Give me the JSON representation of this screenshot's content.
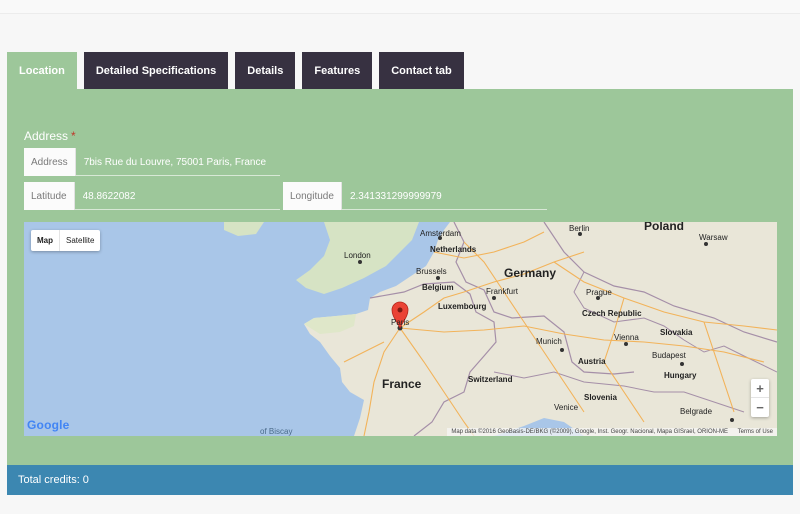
{
  "tabs": [
    {
      "label": "Location"
    },
    {
      "label": "Detailed Specifications"
    },
    {
      "label": "Details"
    },
    {
      "label": "Features"
    },
    {
      "label": "Contact tab"
    }
  ],
  "location": {
    "address_label": "Address",
    "required_marker": "*",
    "address": {
      "addon": "Address",
      "value": "7bis Rue du Louvre, 75001 Paris, France"
    },
    "latitude": {
      "addon": "Latitude",
      "value": "48.8622082"
    },
    "longitude": {
      "addon": "Longitude",
      "value": "2.341331299999979"
    }
  },
  "map": {
    "type_buttons": {
      "map": "Map",
      "satellite": "Satellite"
    },
    "zoom_in": "+",
    "zoom_out": "−",
    "logo": "Google",
    "attribution": "Map data ©2016 GeoBasis-DE/BKG (©2009), Google, Inst. Geogr. Nacional, Mapa GISrael, ORION-ME",
    "terms": "Terms of Use",
    "labels": {
      "poland": "Poland",
      "germany": "Germany",
      "france": "France",
      "london": "London",
      "amsterdam": "Amsterdam",
      "netherlands": "Netherlands",
      "brussels": "Brussels",
      "belgium": "Belgium",
      "luxembourg": "Luxembourg",
      "frankfurt": "Frankfurt",
      "berlin": "Berlin",
      "warsaw": "Warsaw",
      "prague": "Prague",
      "czech": "Czech Republic",
      "slovakia": "Slovakia",
      "munich": "Munich",
      "vienna": "Vienna",
      "austria": "Austria",
      "budapest": "Budapest",
      "hungary": "Hungary",
      "switzerland": "Switzerland",
      "paris": "Paris",
      "slovenia": "Slovenia",
      "venice": "Venice",
      "belgrade": "Belgrade",
      "bay": "of Biscay"
    }
  },
  "footer": {
    "credits": "Total credits: 0"
  }
}
